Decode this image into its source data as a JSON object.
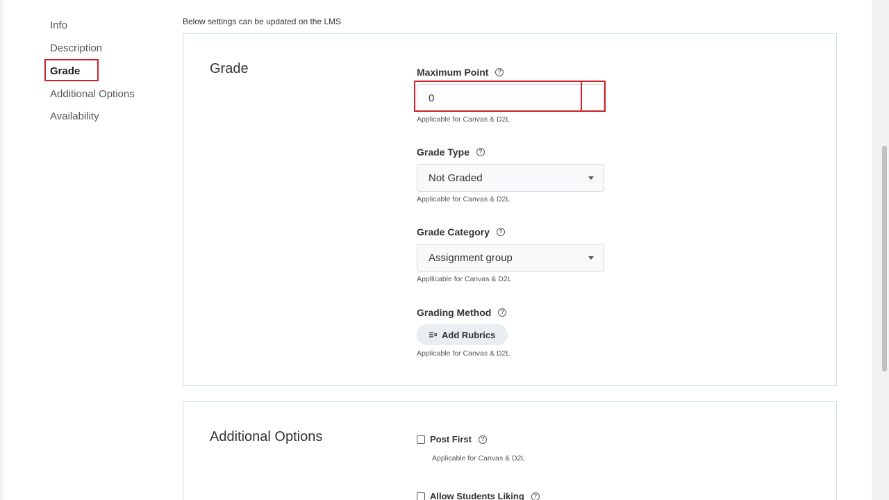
{
  "sidebar": {
    "items": [
      {
        "label": "Info"
      },
      {
        "label": "Description"
      },
      {
        "label": "Grade"
      },
      {
        "label": "Additional Options"
      },
      {
        "label": "Availability"
      }
    ]
  },
  "note": "Below settings can be updated on the LMS",
  "grade_card": {
    "title": "Grade",
    "max_point": {
      "label": "Maximum Point",
      "value": "0",
      "hint": "Applicable for Canvas & D2L"
    },
    "grade_type": {
      "label": "Grade Type",
      "value": "Not Graded",
      "hint": "Applicable for Canvas & D2L"
    },
    "grade_category": {
      "label": "Grade Category",
      "value": "Assignment group",
      "hint": "Appllicable for Canvas & D2L"
    },
    "grading_method": {
      "label": "Grading Method",
      "button_label": "Add Rubrics",
      "hint": "Applicable for Canvas & D2L"
    }
  },
  "options_card": {
    "title": "Additional Options",
    "post_first": {
      "label": "Post First",
      "hint": "Applicable for Canvas & D2L"
    },
    "allow_liking": {
      "label": "Allow Students Liking"
    }
  },
  "help_glyph": "?",
  "colors": {
    "highlight": "#d0202a",
    "card_border": "#cfe0e6"
  },
  "icons": {
    "help": "help-circle-icon",
    "rubric": "rubric-list-icon",
    "dropdown": "caret-down-icon"
  }
}
